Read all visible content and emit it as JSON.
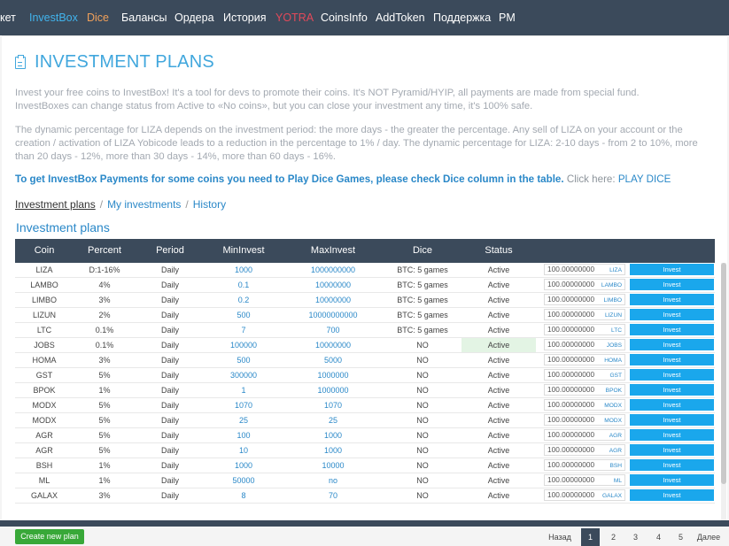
{
  "nav": {
    "items": [
      {
        "label": "кет"
      },
      {
        "label": "InvestBox"
      },
      {
        "label": "Dice"
      },
      {
        "label": "Балансы"
      },
      {
        "label": "Ордера"
      },
      {
        "label": "История"
      },
      {
        "label": "YOTRA"
      },
      {
        "label": "CoinsInfo"
      },
      {
        "label": "AddToken"
      },
      {
        "label": "Поддержка"
      },
      {
        "label": "PM"
      }
    ]
  },
  "page": {
    "title": "INVESTMENT PLANS",
    "desc1_line1": "Invest your free coins to InvestBox! It's a tool for devs to promote their coins. It's NOT Pyramid/HYIP, all payments are made from special fund.",
    "desc1_line2": "InvestBoxes can change status from Active to «No coins», but you can close your investment any time, it's 100% safe.",
    "desc2_line1": "The dynamic percentage for LIZA depends on the investment period: the more days - the greater the percentage. Any sell of LIZA on your account or the",
    "desc2_line2": "creation / activation of LIZA Yobicode leads to a reduction in the percentage to 1% / day. The dynamic percentage for LIZA: 2-10 days - from 2 to 10%, more",
    "desc2_line3": "than 20 days - 12%, more than 30 days - 14%, more than 60 days - 16%.",
    "dice_bold": "To get InvestBox Payments for some coins you need to Play Dice Games, please check Dice column in the table.",
    "dice_click": " Click here: ",
    "dice_link": "PLAY DICE"
  },
  "breadcrumb": {
    "items": [
      "Investment plans",
      "My investments",
      "History"
    ],
    "sep": "/"
  },
  "section_title": "Investment plans",
  "table": {
    "headers": [
      "Coin",
      "Percent",
      "Period",
      "MinInvest",
      "MaxInvest",
      "Dice",
      "Status"
    ],
    "default_amount": "100.00000000",
    "invest_label": "Invest",
    "rows": [
      {
        "coin": "LIZA",
        "percent": "D:1-16%",
        "period": "Daily",
        "min": "1000",
        "max": "1000000000",
        "dice": "BTC: 5 games",
        "status": "Active"
      },
      {
        "coin": "LAMBO",
        "percent": "4%",
        "period": "Daily",
        "min": "0.1",
        "max": "10000000",
        "dice": "BTC: 5 games",
        "status": "Active"
      },
      {
        "coin": "LIMBO",
        "percent": "3%",
        "period": "Daily",
        "min": "0.2",
        "max": "10000000",
        "dice": "BTC: 5 games",
        "status": "Active"
      },
      {
        "coin": "LIZUN",
        "percent": "2%",
        "period": "Daily",
        "min": "500",
        "max": "10000000000",
        "dice": "BTC: 5 games",
        "status": "Active"
      },
      {
        "coin": "LTC",
        "percent": "0.1%",
        "period": "Daily",
        "min": "7",
        "max": "700",
        "dice": "BTC: 5 games",
        "status": "Active"
      },
      {
        "coin": "JOBS",
        "percent": "0.1%",
        "period": "Daily",
        "min": "100000",
        "max": "10000000",
        "dice": "NO",
        "status": "Active"
      },
      {
        "coin": "HOMA",
        "percent": "3%",
        "period": "Daily",
        "min": "500",
        "max": "5000",
        "dice": "NO",
        "status": "Active"
      },
      {
        "coin": "GST",
        "percent": "5%",
        "period": "Daily",
        "min": "300000",
        "max": "1000000",
        "dice": "NO",
        "status": "Active"
      },
      {
        "coin": "BPOK",
        "percent": "1%",
        "period": "Daily",
        "min": "1",
        "max": "1000000",
        "dice": "NO",
        "status": "Active"
      },
      {
        "coin": "MODX",
        "percent": "5%",
        "period": "Daily",
        "min": "1070",
        "max": "1070",
        "dice": "NO",
        "status": "Active"
      },
      {
        "coin": "MODX",
        "percent": "5%",
        "period": "Daily",
        "min": "25",
        "max": "25",
        "dice": "NO",
        "status": "Active"
      },
      {
        "coin": "AGR",
        "percent": "5%",
        "period": "Daily",
        "min": "100",
        "max": "1000",
        "dice": "NO",
        "status": "Active"
      },
      {
        "coin": "AGR",
        "percent": "5%",
        "period": "Daily",
        "min": "10",
        "max": "1000",
        "dice": "NO",
        "status": "Active"
      },
      {
        "coin": "BSH",
        "percent": "1%",
        "period": "Daily",
        "min": "1000",
        "max": "10000",
        "dice": "NO",
        "status": "Active"
      },
      {
        "coin": "ML",
        "percent": "1%",
        "period": "Daily",
        "min": "50000",
        "max": "no",
        "dice": "NO",
        "status": "Active"
      },
      {
        "coin": "GALAX",
        "percent": "3%",
        "period": "Daily",
        "min": "8",
        "max": "70",
        "dice": "NO",
        "status": "Active"
      }
    ]
  },
  "buttons": {
    "create_plan": "Create new plan"
  },
  "pagination": {
    "prev": "Назад",
    "pages": [
      "1",
      "2",
      "3",
      "4",
      "5"
    ],
    "next": "Далее",
    "current": "1"
  },
  "colors": {
    "nav_bg": "#3b4a5b",
    "accent": "#41a7dd",
    "invest_button": "#1aa7ec",
    "create_button": "#38a838",
    "dice_nav": "#f0a05a",
    "yotra_nav": "#e3495a"
  }
}
